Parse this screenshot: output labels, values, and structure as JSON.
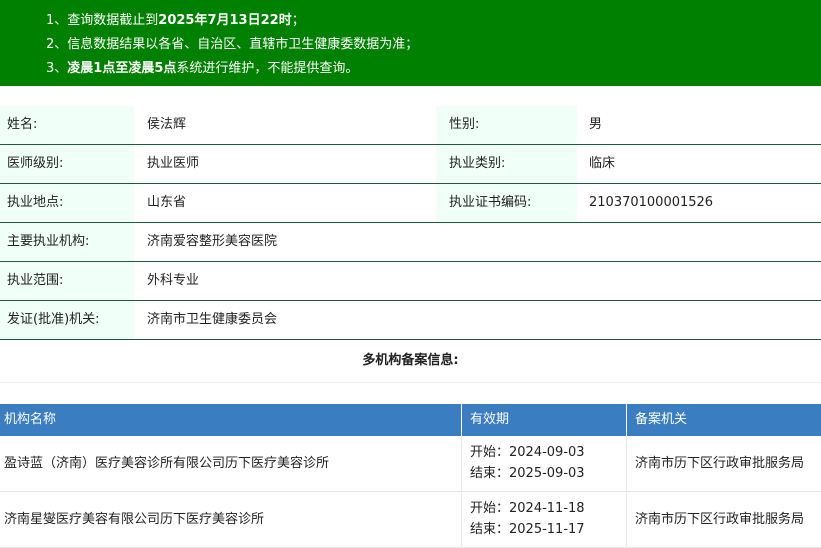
{
  "notice": {
    "line1_prefix": "1、查询数据截止到",
    "line1_bold": "2025年7月13日22时",
    "line1_suffix": "；",
    "line2": "2、信息数据结果以各省、自治区、直辖市卫生健康委数据为准；",
    "line3_prefix": "3、",
    "line3_bold": "凌晨1点至凌晨5点",
    "line3_suffix": "系统进行维护，不能提供查询。"
  },
  "info": {
    "name_label": "姓名:",
    "name_value": "侯法辉",
    "gender_label": "性别:",
    "gender_value": "男",
    "level_label": "医师级别:",
    "level_value": "执业医师",
    "category_label": "执业类别:",
    "category_value": "临床",
    "place_label": "执业地点:",
    "place_value": "山东省",
    "cert_label": "执业证书编码:",
    "cert_value": "210370100001526",
    "org_label": "主要执业机构:",
    "org_value": "济南爱容整形美容医院",
    "scope_label": "执业范围:",
    "scope_value": "外科专业",
    "issuer_label": "发证(批准)机关:",
    "issuer_value": "济南市卫生健康委员会"
  },
  "multi": {
    "title": "多机构备案信息:",
    "headers": [
      "机构名称",
      "有效期",
      "备案机关"
    ],
    "rows": [
      {
        "name": "盈诗蓝（济南）医疗美容诊所有限公司历下医疗美容诊所",
        "start": "开始：2024-09-03",
        "end": "结束：2025-09-03",
        "authority": "济南市历下区行政审批服务局"
      },
      {
        "name": "济南星燮医疗美容有限公司历下医疗美容诊所",
        "start": "开始：2024-11-18",
        "end": "结束：2025-11-17",
        "authority": "济南市历下区行政审批服务局"
      }
    ]
  }
}
